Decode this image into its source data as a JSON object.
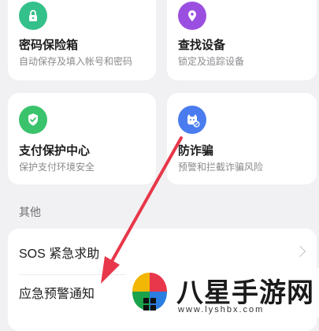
{
  "cards": [
    {
      "title": "密码保险箱",
      "subtitle": "自动保存及填入帐号和密码",
      "icon": "lock-icon",
      "color": "#34c08a"
    },
    {
      "title": "查找设备",
      "subtitle": "锁定及追踪设备",
      "icon": "location-pin-icon",
      "color": "#9b4fe0"
    },
    {
      "title": "支付保护中心",
      "subtitle": "保护支付环境安全",
      "icon": "shield-check-icon",
      "color": "#3ac36c"
    },
    {
      "title": "防诈骗",
      "subtitle": "预警和拦截诈骗风险",
      "icon": "anti-fraud-icon",
      "color": "#4a7cf0"
    }
  ],
  "section": {
    "label": "其他"
  },
  "rows": [
    {
      "label": "SOS 紧急求助"
    },
    {
      "label": "应急预警通知"
    }
  ],
  "watermark": {
    "text": "八星手游网",
    "url": "www.lyshbx.com"
  },
  "annotation": {
    "arrow_color": "#e8374a"
  }
}
